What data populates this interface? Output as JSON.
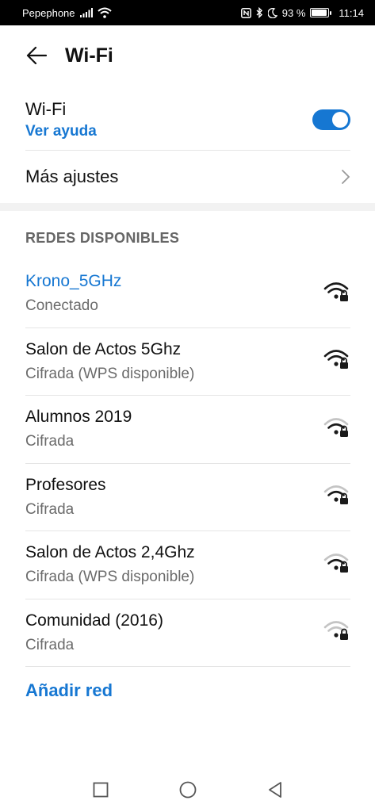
{
  "status_bar": {
    "carrier": "Pepephone",
    "battery_percent": "93 %",
    "battery_level": 0.93,
    "time": "11:14",
    "icons": [
      "signal-icon",
      "wifi-icon",
      "nfc-icon",
      "bluetooth-icon",
      "moon-icon",
      "battery-icon"
    ]
  },
  "header": {
    "title": "Wi-Fi"
  },
  "wifi_toggle": {
    "label": "Wi-Fi",
    "help_link": "Ver ayuda",
    "enabled": true
  },
  "more_settings": {
    "label": "Más ajustes"
  },
  "networks": {
    "section_title": "REDES DISPONIBLES",
    "items": [
      {
        "name": "Krono_5GHz",
        "status": "Conectado",
        "connected": true,
        "signal": "strong"
      },
      {
        "name": "Salon de Actos 5Ghz",
        "status": "Cifrada (WPS disponible)",
        "connected": false,
        "signal": "strong"
      },
      {
        "name": "Alumnos 2019",
        "status": "Cifrada",
        "connected": false,
        "signal": "medium"
      },
      {
        "name": "Profesores",
        "status": "Cifrada",
        "connected": false,
        "signal": "medium"
      },
      {
        "name": "Salon de Actos 2,4Ghz",
        "status": "Cifrada (WPS disponible)",
        "connected": false,
        "signal": "medium"
      },
      {
        "name": "Comunidad (2016)",
        "status": "Cifrada",
        "connected": false,
        "signal": "weak"
      }
    ]
  },
  "add_network": {
    "label": "Añadir red"
  },
  "colors": {
    "accent": "#1677d2",
    "text_primary": "#111111",
    "text_secondary": "#6b6b6b"
  }
}
